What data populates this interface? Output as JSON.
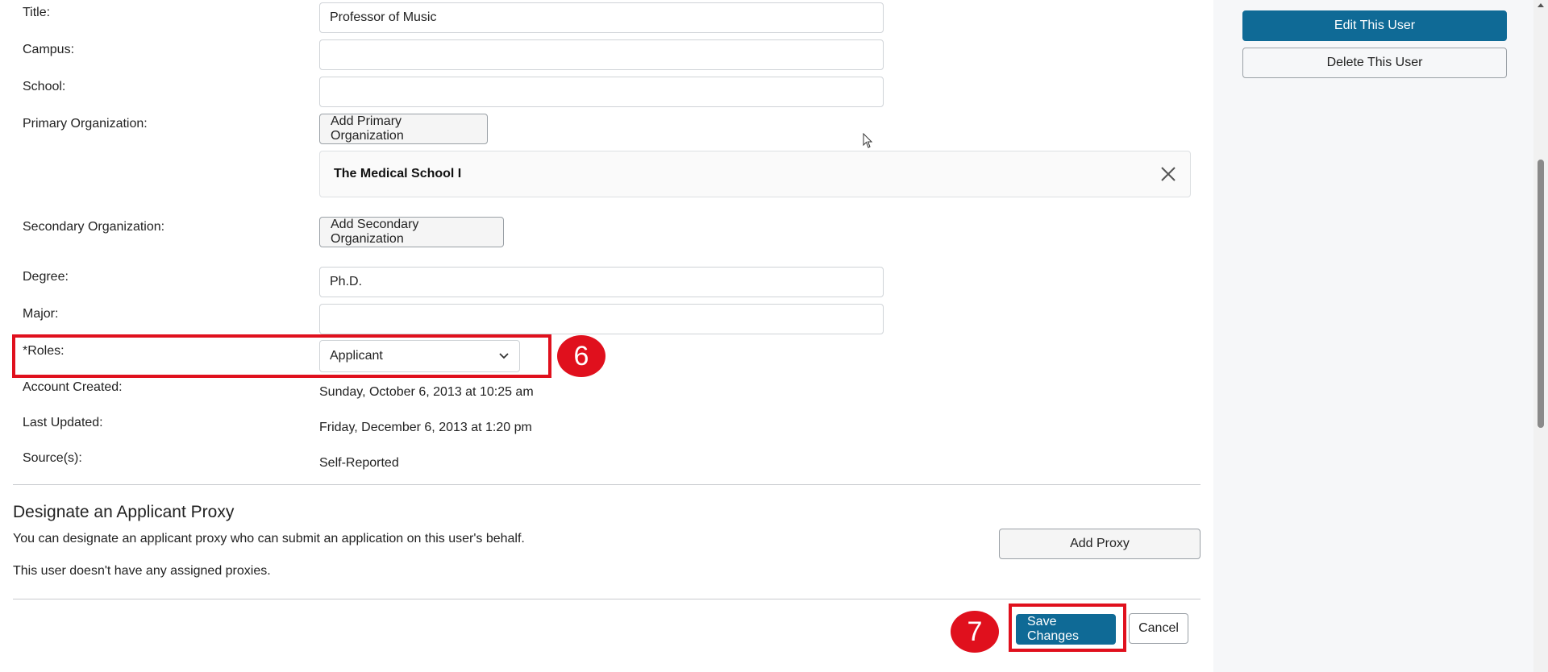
{
  "form": {
    "title_label": "Title:",
    "title_value": "Professor of Music",
    "campus_label": "Campus:",
    "campus_value": "",
    "school_label": "School:",
    "school_value": "",
    "primary_org_label": "Primary Organization:",
    "add_primary_org_button": "Add Primary Organization",
    "primary_org_selected": "The Medical School I",
    "secondary_org_label": "Secondary Organization:",
    "add_secondary_org_button": "Add Secondary Organization",
    "degree_label": "Degree:",
    "degree_value": "Ph.D.",
    "major_label": "Major:",
    "major_value": "",
    "roles_label": "*Roles:",
    "roles_value": "Applicant",
    "account_created_label": "Account Created:",
    "account_created_value": "Sunday, October 6, 2013 at 10:25 am",
    "last_updated_label": "Last Updated:",
    "last_updated_value": "Friday, December 6, 2013 at 1:20 pm",
    "sources_label": "Source(s):",
    "sources_value": "Self-Reported"
  },
  "proxy": {
    "heading": "Designate an Applicant Proxy",
    "description": "You can designate an applicant proxy who can submit an application on this user's behalf.",
    "empty_text": "This user doesn't have any assigned proxies.",
    "add_button": "Add Proxy"
  },
  "footer": {
    "save_button": "Save Changes",
    "cancel_button": "Cancel"
  },
  "sidebar": {
    "edit_button": "Edit This User",
    "delete_button": "Delete This User"
  },
  "annotations": {
    "step_roles": "6",
    "step_save": "7",
    "color": "#e0101d"
  },
  "colors": {
    "primary": "#0f6a96",
    "sidebar_bg": "#f6f7f9"
  },
  "icons": {
    "org_remove": "close-icon",
    "roles_dropdown": "chevron-down-icon",
    "pointer": "mouse-cursor-icon"
  }
}
